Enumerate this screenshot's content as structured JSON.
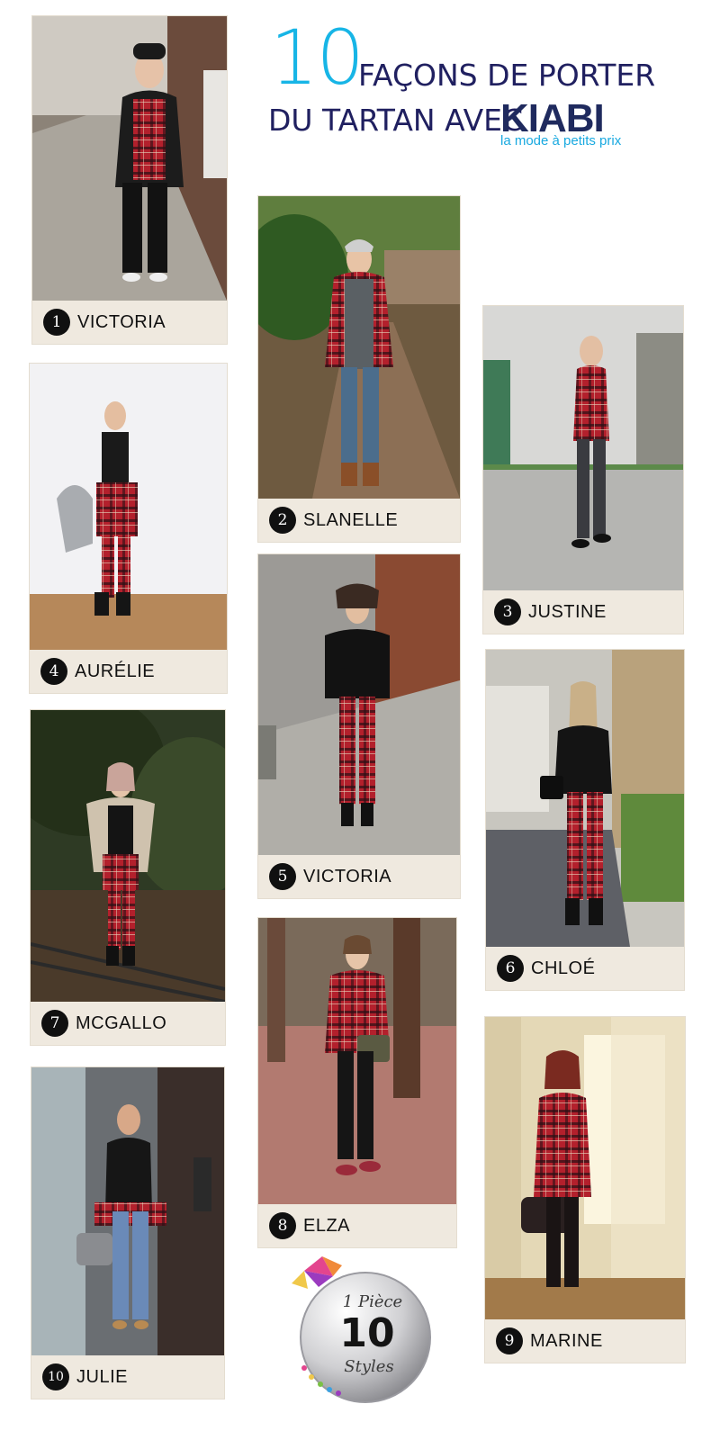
{
  "header": {
    "title_number": "10",
    "title_line1": "FAÇONS DE PORTER",
    "title_line2": "DU TARTAN AVEC",
    "brand": "KIABI",
    "tagline": "la mode à petits prix"
  },
  "looks": [
    {
      "number": "1",
      "name": "VICTORIA"
    },
    {
      "number": "2",
      "name": "SLANELLE"
    },
    {
      "number": "3",
      "name": "JUSTINE"
    },
    {
      "number": "4",
      "name": "AURÉLIE"
    },
    {
      "number": "5",
      "name": "VICTORIA"
    },
    {
      "number": "6",
      "name": "CHLOÉ"
    },
    {
      "number": "7",
      "name": "MCGALLO"
    },
    {
      "number": "8",
      "name": "ELZA"
    },
    {
      "number": "9",
      "name": "MARINE"
    },
    {
      "number": "10",
      "name": "JULIE"
    }
  ],
  "seal": {
    "line1": "1 Pièce",
    "number": "10",
    "line2": "Styles"
  },
  "colors": {
    "title_accent": "#17b5e6",
    "title_dark": "#202060",
    "brand": "#1f2a5e",
    "tartan_red": "#b3202c",
    "label_bg": "#efe9df"
  }
}
